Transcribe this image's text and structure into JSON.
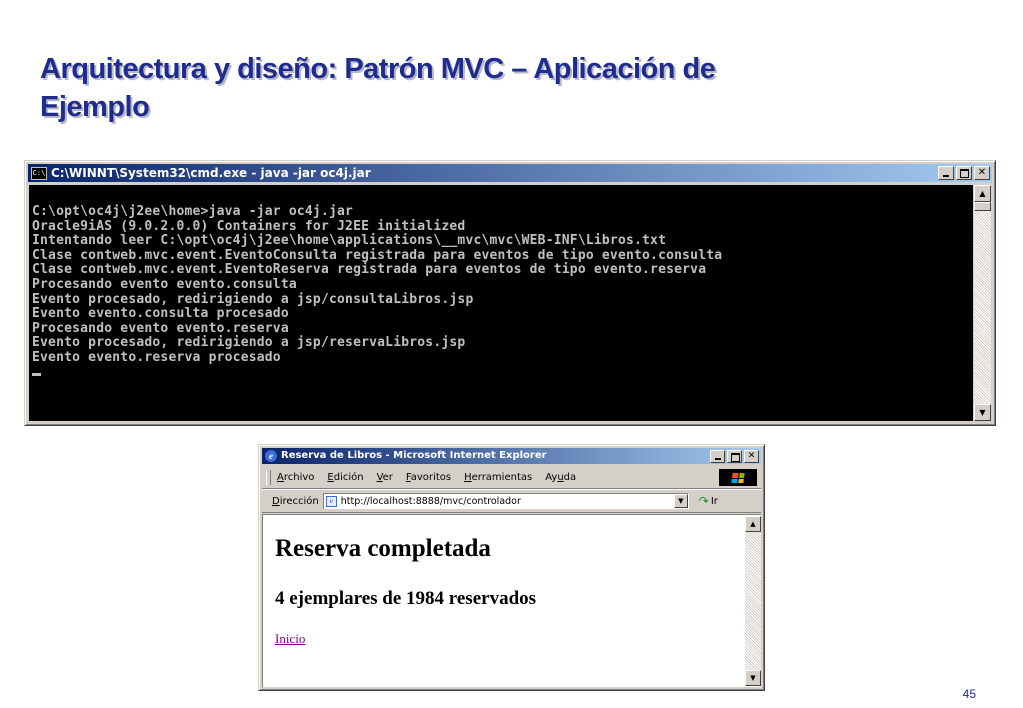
{
  "slide": {
    "title_line1": "Arquitectura y diseño: Patrón MVC – Aplicación de",
    "title_line2": "Ejemplo",
    "page_number": "45"
  },
  "cmd_window": {
    "title": "C:\\WINNT\\System32\\cmd.exe - java -jar oc4j.jar",
    "icon": "console-icon",
    "lines": [
      "C:\\opt\\oc4j\\j2ee\\home>java -jar oc4j.jar",
      "Oracle9iAS (9.0.2.0.0) Containers for J2EE initialized",
      "Intentando leer C:\\opt\\oc4j\\j2ee\\home\\applications\\__mvc\\mvc\\WEB-INF\\Libros.txt",
      "Clase contweb.mvc.event.EventoConsulta registrada para eventos de tipo evento.consulta",
      "Clase contweb.mvc.event.EventoReserva registrada para eventos de tipo evento.reserva",
      "Procesando evento evento.consulta",
      "Evento procesado, redirigiendo a jsp/consultaLibros.jsp",
      "Evento evento.consulta procesado",
      "Procesando evento evento.reserva",
      "Evento procesado, redirigiendo a jsp/reservaLibros.jsp",
      "Evento evento.reserva procesado"
    ]
  },
  "browser": {
    "title": "Reserva de Libros - Microsoft Internet Explorer",
    "menu": [
      {
        "underlined": "A",
        "rest": "rchivo"
      },
      {
        "underlined": "E",
        "rest": "dición"
      },
      {
        "underlined": "V",
        "rest": "er"
      },
      {
        "underlined": "F",
        "rest": "avoritos"
      },
      {
        "underlined": "H",
        "rest": "erramientas"
      },
      {
        "pre": "Ay",
        "underlined": "u",
        "rest": "da"
      }
    ],
    "address_label_underlined": "D",
    "address_label_rest": "irección",
    "url": "http://localhost:8888/mvc/controlador",
    "go_label": "Ir",
    "page": {
      "heading": "Reserva completada",
      "subheading": "4 ejemplares de 1984 reservados",
      "link": "Inicio"
    }
  },
  "colors": {
    "title_blue": "#1f2c8f",
    "titlebar_start": "#0a246a",
    "titlebar_end": "#a6caf0",
    "visited_link": "#800080"
  }
}
